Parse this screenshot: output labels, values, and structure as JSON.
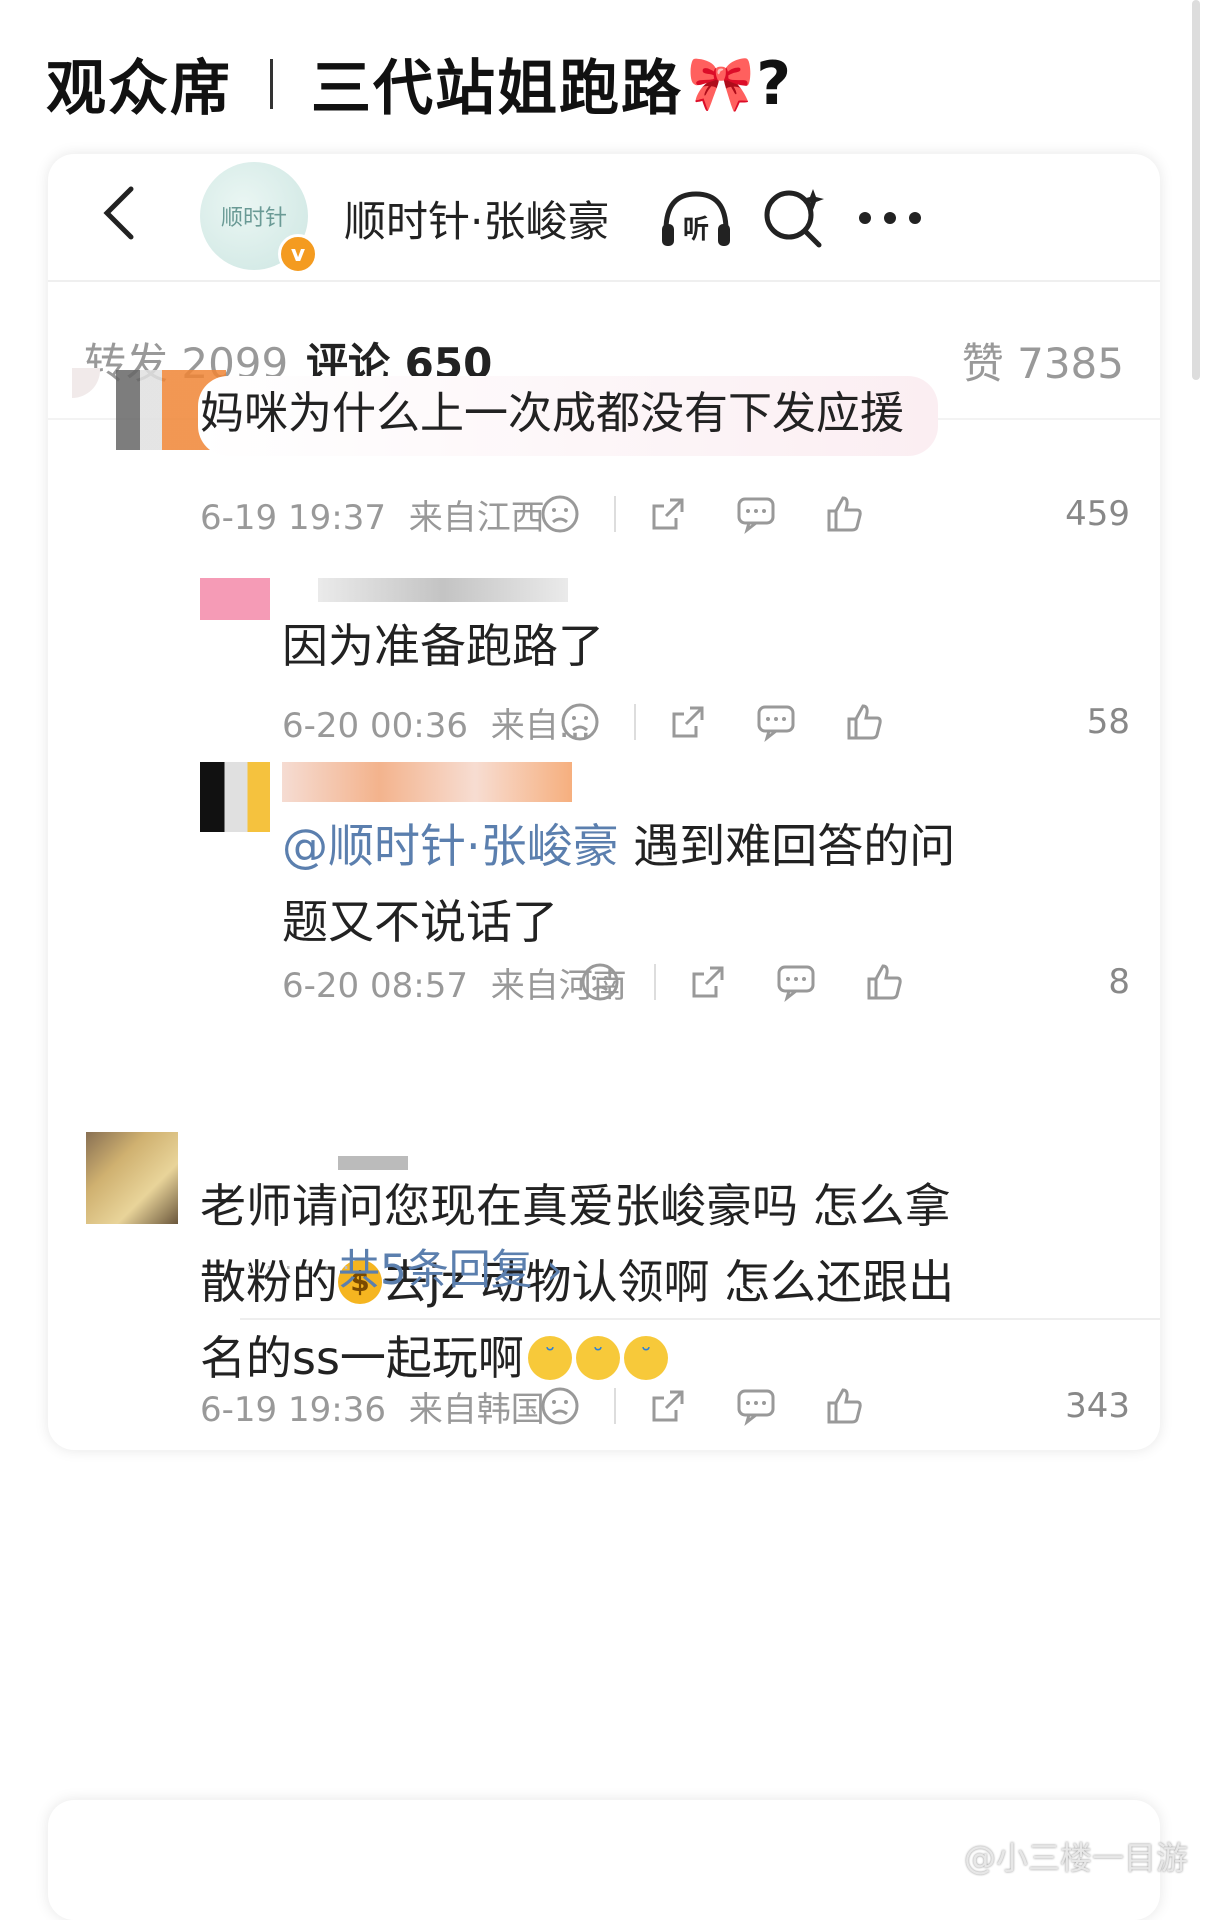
{
  "headline": {
    "left": "观众席",
    "right": "三代站姐跑路",
    "bow": "🎀",
    "tail": "?"
  },
  "account": {
    "name": "顺时针·张峻豪",
    "avatar_text": "顺时针"
  },
  "header_icons": {
    "listen": "听"
  },
  "tabs": [
    {
      "label": "转发 2099"
    },
    {
      "label": "评论 650"
    },
    {
      "label": "赞 7385"
    }
  ],
  "comments": [
    {
      "text": "妈咪为什么上一次成都没有下发应援",
      "time": "6-19 19:37",
      "location": "来自江西",
      "likes": "459"
    },
    {
      "text": "因为准备跑路了",
      "time": "6-20 00:36",
      "location": "来自...",
      "likes": "58"
    },
    {
      "mention": "@顺时针·张峻豪",
      "text_line1": " 遇到难回答的问",
      "text_line2": "题又不说话了",
      "time": "6-20 08:57",
      "location": "来自河南",
      "likes": "8"
    },
    {
      "line1": "老师请问您现在真爱张峻豪吗 怎么拿",
      "line2a": "散粉的",
      "line2b": "去jz 动物认领啊 怎么还跟出",
      "line3": "名的ss一起玩啊",
      "time": "6-19 19:36",
      "location": "来自韩国",
      "likes": "343"
    }
  ],
  "more_replies": "共5条回复 ›",
  "watermark": "@小三楼一目游",
  "colors": {
    "accent": "#f7a21c",
    "link": "#5b7fae",
    "vbadge": "#f49b20"
  }
}
